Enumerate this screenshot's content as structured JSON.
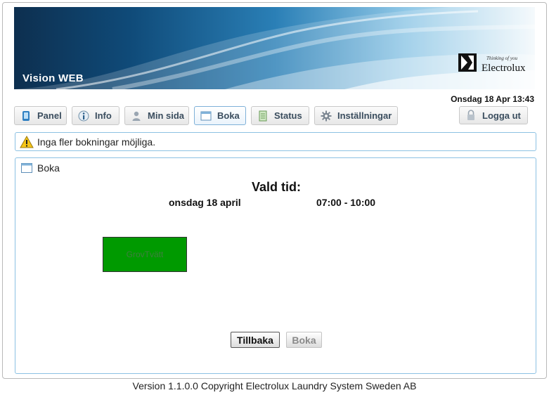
{
  "header": {
    "app_title": "Vision WEB",
    "logo_tagline": "Thinking of you",
    "logo_text": "Electrolux",
    "datetime": "Onsdag 18 Apr 13:43"
  },
  "nav": {
    "items": [
      {
        "label": "Panel",
        "icon": "tablet-icon"
      },
      {
        "label": "Info",
        "icon": "info-icon"
      },
      {
        "label": "Min sida",
        "icon": "user-icon"
      },
      {
        "label": "Boka",
        "icon": "window-icon",
        "active": true
      },
      {
        "label": "Status",
        "icon": "document-icon"
      },
      {
        "label": "Inställningar",
        "icon": "gear-icon"
      }
    ],
    "logout_label": "Logga ut"
  },
  "alert": {
    "message": "Inga fler bokningar möjliga.",
    "icon": "warning-icon"
  },
  "panel": {
    "title": "Boka",
    "heading": "Vald tid:",
    "date": "onsdag 18 april",
    "time": "07:00 - 10:00",
    "machine_label": "GrovTvätt",
    "machine_color": "#009a00",
    "back_label": "Tillbaka",
    "book_label": "Boka"
  },
  "footer": {
    "text": "Version 1.1.0.0 Copyright Electrolux Laundry System Sweden AB"
  }
}
